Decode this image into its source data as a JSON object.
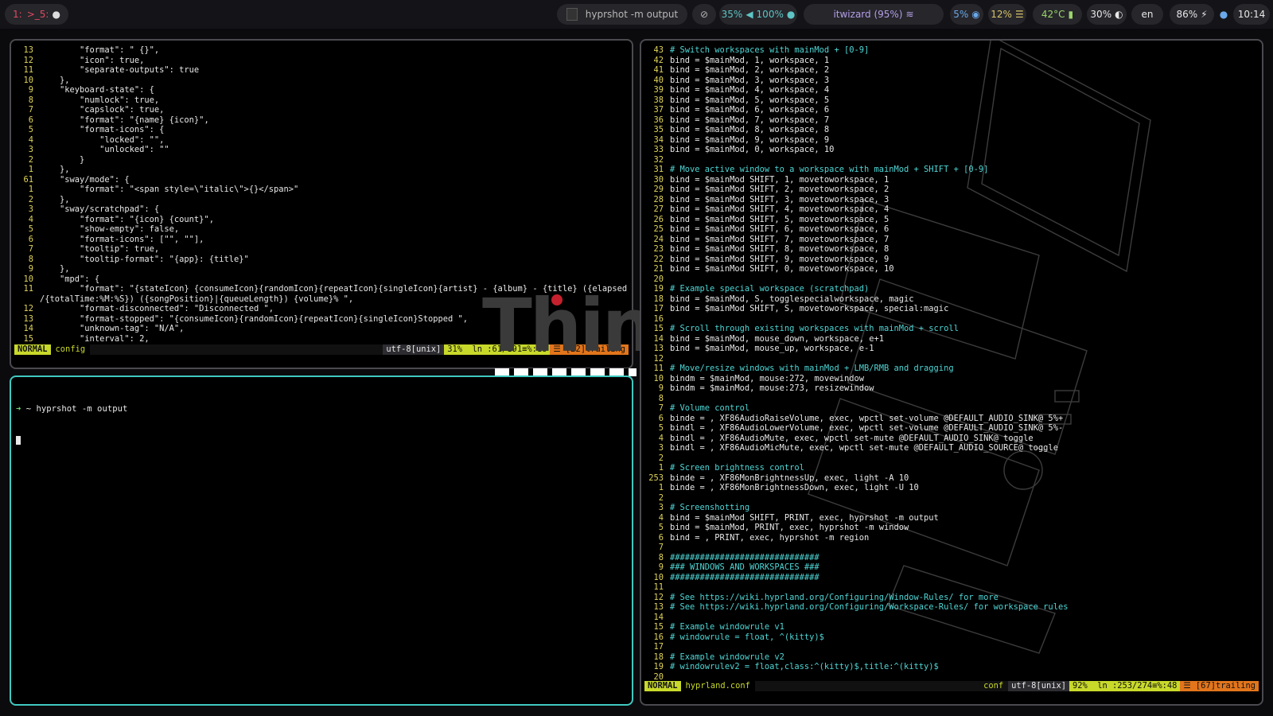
{
  "topbar": {
    "workspaces": "1:  5:",
    "workspace_1": "1:",
    "workspace_5": "5:",
    "window_title": "hyprshot -m output",
    "brightness": "35%",
    "volume": "100%",
    "network": "itwizard (95%)",
    "cpu": "5%",
    "memory": "12%",
    "temperature": "42°C",
    "backlight": "30%",
    "keyboard_layout": "en",
    "battery": "86%",
    "clock": "10:14"
  },
  "editor_left": {
    "lines": [
      {
        "n": "13",
        "t": "        \"format\": \" {}\","
      },
      {
        "n": "12",
        "t": "        \"icon\": true,"
      },
      {
        "n": "11",
        "t": "        \"separate-outputs\": true"
      },
      {
        "n": "10",
        "t": "    },"
      },
      {
        "n": "9",
        "t": "    \"keyboard-state\": {"
      },
      {
        "n": "8",
        "t": "        \"numlock\": true,"
      },
      {
        "n": "7",
        "t": "        \"capslock\": true,"
      },
      {
        "n": "6",
        "t": "        \"format\": \"{name} {icon}\","
      },
      {
        "n": "5",
        "t": "        \"format-icons\": {"
      },
      {
        "n": "4",
        "t": "            \"locked\": \"\","
      },
      {
        "n": "3",
        "t": "            \"unlocked\": \"\""
      },
      {
        "n": "2",
        "t": "        }"
      },
      {
        "n": "1",
        "t": "    },"
      },
      {
        "n": "61",
        "t": "    \"sway/mode\": {"
      },
      {
        "n": "1",
        "t": "        \"format\": \"<span style=\\\"italic\\\">{}</span>\""
      },
      {
        "n": "2",
        "t": "    },"
      },
      {
        "n": "3",
        "t": "    \"sway/scratchpad\": {"
      },
      {
        "n": "4",
        "t": "        \"format\": \"{icon} {count}\","
      },
      {
        "n": "5",
        "t": "        \"show-empty\": false,"
      },
      {
        "n": "6",
        "t": "        \"format-icons\": [\"\", \"\"],"
      },
      {
        "n": "7",
        "t": "        \"tooltip\": true,"
      },
      {
        "n": "8",
        "t": "        \"tooltip-format\": \"{app}: {title}\""
      },
      {
        "n": "9",
        "t": "    },"
      },
      {
        "n": "10",
        "t": "    \"mpd\": {"
      },
      {
        "n": "11",
        "t": "        \"format\": \"{stateIcon} {consumeIcon}{randomIcon}{repeatIcon}{singleIcon}{artist} - {album} - {title} ({elapsedTime:%M:%S}"
      },
      {
        "n": "",
        "t": "/{totalTime:%M:%S}) ({songPosition}|{queueLength}) {volume}% \","
      },
      {
        "n": "12",
        "t": "        \"format-disconnected\": \"Disconnected \","
      },
      {
        "n": "13",
        "t": "        \"format-stopped\": \"{consumeIcon}{randomIcon}{repeatIcon}{singleIcon}Stopped \","
      },
      {
        "n": "14",
        "t": "        \"unknown-tag\": \"N/A\","
      },
      {
        "n": "15",
        "t": "        \"interval\": 2,"
      }
    ],
    "status": {
      "mode": "NORMAL",
      "file": "config",
      "encoding": "utf-8[unix]",
      "position": "31%  ln :61/191≡%:18",
      "warning": "☰ [22]trailing"
    }
  },
  "wallpaper_text": "Think",
  "terminal": {
    "prompt_arrow": "➜",
    "prompt": " ~ hyprshot -m output"
  },
  "editor_right": {
    "lines": [
      {
        "n": "43",
        "t": "# Switch workspaces with mainMod + [0-9]",
        "c": true
      },
      {
        "n": "42",
        "t": "bind = $mainMod, 1, workspace, 1"
      },
      {
        "n": "41",
        "t": "bind = $mainMod, 2, workspace, 2"
      },
      {
        "n": "40",
        "t": "bind = $mainMod, 3, workspace, 3"
      },
      {
        "n": "39",
        "t": "bind = $mainMod, 4, workspace, 4"
      },
      {
        "n": "38",
        "t": "bind = $mainMod, 5, workspace, 5"
      },
      {
        "n": "37",
        "t": "bind = $mainMod, 6, workspace, 6"
      },
      {
        "n": "36",
        "t": "bind = $mainMod, 7, workspace, 7"
      },
      {
        "n": "35",
        "t": "bind = $mainMod, 8, workspace, 8"
      },
      {
        "n": "34",
        "t": "bind = $mainMod, 9, workspace, 9"
      },
      {
        "n": "33",
        "t": "bind = $mainMod, 0, workspace, 10"
      },
      {
        "n": "32",
        "t": ""
      },
      {
        "n": "31",
        "t": "# Move active window to a workspace with mainMod + SHIFT + [0-9]",
        "c": true
      },
      {
        "n": "30",
        "t": "bind = $mainMod SHIFT, 1, movetoworkspace, 1"
      },
      {
        "n": "29",
        "t": "bind = $mainMod SHIFT, 2, movetoworkspace, 2"
      },
      {
        "n": "28",
        "t": "bind = $mainMod SHIFT, 3, movetoworkspace, 3"
      },
      {
        "n": "27",
        "t": "bind = $mainMod SHIFT, 4, movetoworkspace, 4"
      },
      {
        "n": "26",
        "t": "bind = $mainMod SHIFT, 5, movetoworkspace, 5"
      },
      {
        "n": "25",
        "t": "bind = $mainMod SHIFT, 6, movetoworkspace, 6"
      },
      {
        "n": "24",
        "t": "bind = $mainMod SHIFT, 7, movetoworkspace, 7"
      },
      {
        "n": "23",
        "t": "bind = $mainMod SHIFT, 8, movetoworkspace, 8"
      },
      {
        "n": "22",
        "t": "bind = $mainMod SHIFT, 9, movetoworkspace, 9"
      },
      {
        "n": "21",
        "t": "bind = $mainMod SHIFT, 0, movetoworkspace, 10"
      },
      {
        "n": "20",
        "t": ""
      },
      {
        "n": "19",
        "t": "# Example special workspace (scratchpad)",
        "c": true
      },
      {
        "n": "18",
        "t": "bind = $mainMod, S, togglespecialworkspace, magic"
      },
      {
        "n": "17",
        "t": "bind = $mainMod SHIFT, S, movetoworkspace, special:magic"
      },
      {
        "n": "16",
        "t": ""
      },
      {
        "n": "15",
        "t": "# Scroll through existing workspaces with mainMod + scroll",
        "c": true
      },
      {
        "n": "14",
        "t": "bind = $mainMod, mouse_down, workspace, e+1"
      },
      {
        "n": "13",
        "t": "bind = $mainMod, mouse_up, workspace, e-1"
      },
      {
        "n": "12",
        "t": ""
      },
      {
        "n": "11",
        "t": "# Move/resize windows with mainMod + LMB/RMB and dragging",
        "c": true
      },
      {
        "n": "10",
        "t": "bindm = $mainMod, mouse:272, movewindow"
      },
      {
        "n": "9",
        "t": "bindm = $mainMod, mouse:273, resizewindow"
      },
      {
        "n": "8",
        "t": ""
      },
      {
        "n": "7",
        "t": "# Volume control",
        "c": true
      },
      {
        "n": "6",
        "t": "binde = , XF86AudioRaiseVolume, exec, wpctl set-volume @DEFAULT_AUDIO_SINK@ 5%+"
      },
      {
        "n": "5",
        "t": "bindl = , XF86AudioLowerVolume, exec, wpctl set-volume @DEFAULT_AUDIO_SINK@ 5%-"
      },
      {
        "n": "4",
        "t": "bindl = , XF86AudioMute, exec, wpctl set-mute @DEFAULT_AUDIO_SINK@ toggle"
      },
      {
        "n": "3",
        "t": "bindl = , XF86AudioMicMute, exec, wpctl set-mute @DEFAULT_AUDIO_SOURCE@ toggle"
      },
      {
        "n": "2",
        "t": ""
      },
      {
        "n": "1",
        "t": "# Screen brightness control",
        "c": true
      },
      {
        "n": "253",
        "t": "binde = , XF86MonBrightnessUp, exec, light -A 10"
      },
      {
        "n": "1",
        "t": "binde = , XF86MonBrightnessDown, exec, light -U 10"
      },
      {
        "n": "2",
        "t": ""
      },
      {
        "n": "3",
        "t": "# Screenshotting",
        "c": true
      },
      {
        "n": "4",
        "t": "bind = $mainMod SHIFT, PRINT, exec, hyprshot -m output"
      },
      {
        "n": "5",
        "t": "bind = $mainMod, PRINT, exec, hyprshot -m window"
      },
      {
        "n": "6",
        "t": "bind = , PRINT, exec, hyprshot -m region"
      },
      {
        "n": "7",
        "t": ""
      },
      {
        "n": "8",
        "t": "##############################",
        "c": true
      },
      {
        "n": "9",
        "t": "### WINDOWS AND WORKSPACES ###",
        "c": true
      },
      {
        "n": "10",
        "t": "##############################",
        "c": true
      },
      {
        "n": "11",
        "t": ""
      },
      {
        "n": "12",
        "t": "# See https://wiki.hyprland.org/Configuring/Window-Rules/ for more",
        "c": true
      },
      {
        "n": "13",
        "t": "# See https://wiki.hyprland.org/Configuring/Workspace-Rules/ for workspace rules",
        "c": true
      },
      {
        "n": "14",
        "t": ""
      },
      {
        "n": "15",
        "t": "# Example windowrule v1",
        "c": true
      },
      {
        "n": "16",
        "t": "# windowrule = float, ^(kitty)$",
        "c": true
      },
      {
        "n": "17",
        "t": ""
      },
      {
        "n": "18",
        "t": "# Example windowrule v2",
        "c": true
      },
      {
        "n": "19",
        "t": "# windowrulev2 = float,class:^(kitty)$,title:^(kitty)$",
        "c": true
      },
      {
        "n": "20",
        "t": ""
      }
    ],
    "status": {
      "mode": "NORMAL",
      "file": "hyprland.conf",
      "filetype": "conf",
      "encoding": "utf-8[unix]",
      "position": "92%  ln :253/274≡%:48",
      "warning": "☰ [67]trailing"
    }
  },
  "colors": {
    "accent_teal": "#3fc9c0",
    "statusline_yellow": "#c8d92a",
    "warning_orange": "#e2751b",
    "comment_cyan": "#4fd6d6"
  }
}
